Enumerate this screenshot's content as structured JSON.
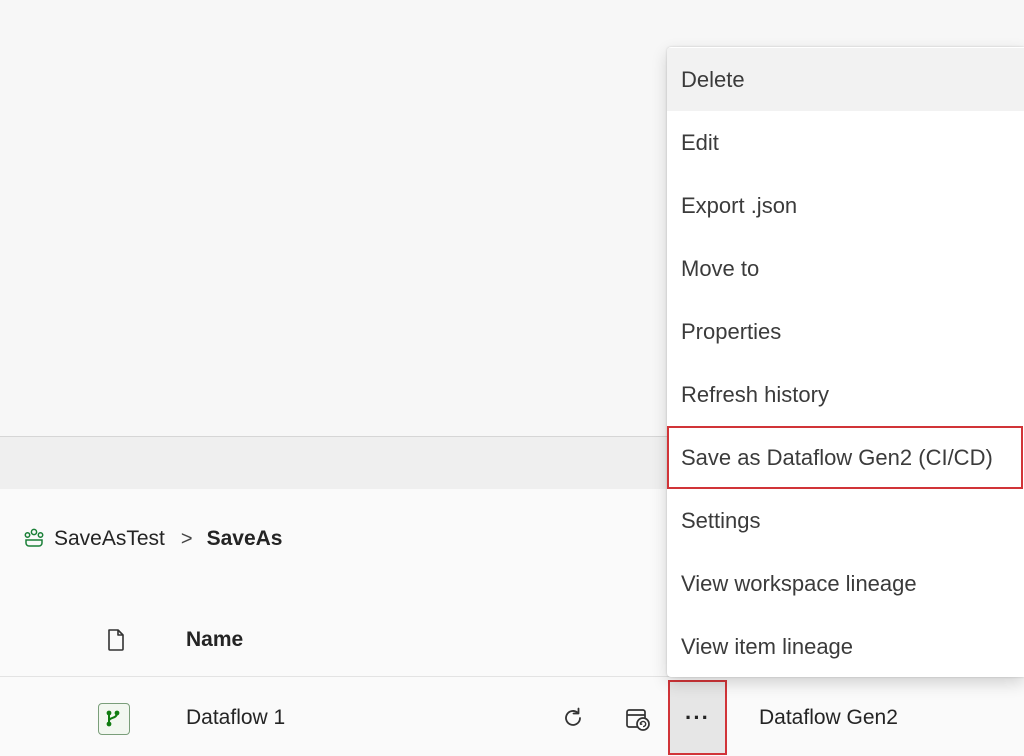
{
  "breadcrumb": {
    "workspace": "SaveAsTest",
    "separator": ">",
    "current": "SaveAs"
  },
  "table": {
    "columns": {
      "name": "Name"
    },
    "rows": [
      {
        "name": "Dataflow 1",
        "type": "Dataflow Gen2",
        "more_label": "···"
      }
    ]
  },
  "context_menu": {
    "items": [
      {
        "label": "Delete",
        "state": "hover"
      },
      {
        "label": "Edit"
      },
      {
        "label": "Export .json"
      },
      {
        "label": "Move to"
      },
      {
        "label": "Properties"
      },
      {
        "label": "Refresh history"
      },
      {
        "label": "Save as Dataflow Gen2 (CI/CD)",
        "state": "highlighted"
      },
      {
        "label": "Settings"
      },
      {
        "label": "View workspace lineage"
      },
      {
        "label": "View item lineage"
      }
    ]
  },
  "colors": {
    "highlight_border": "#d13438",
    "dataflow_icon": "#107c10"
  },
  "icons": {
    "workspace": "workspace-icon",
    "file_type": "document-icon",
    "item_type": "dataflow-icon",
    "refresh": "refresh-icon",
    "schedule": "schedule-icon",
    "more": "more-options-icon"
  }
}
